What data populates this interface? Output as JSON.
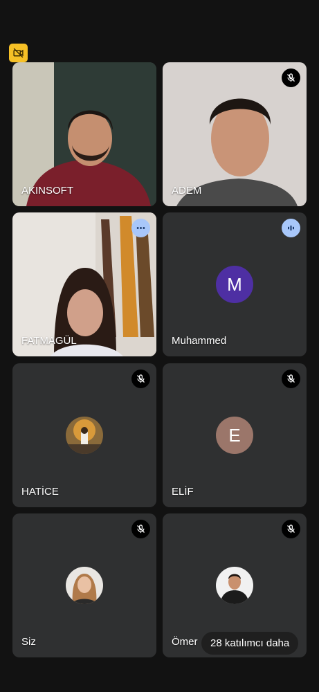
{
  "colors": {
    "background": "#121212",
    "tile": "#2f3031",
    "badge": "#f6c026",
    "accent_light_blue": "#a8c7fa",
    "avatar_m": "#4e2fa3",
    "avatar_e": "#9b766a"
  },
  "top_badge": {
    "icon": "camera-off-icon"
  },
  "participants": [
    {
      "name": "AKINSOFT",
      "tile": "video",
      "mic": "on"
    },
    {
      "name": "ADEM",
      "tile": "video",
      "mic": "muted"
    },
    {
      "name": "FATMAGÜL",
      "tile": "video",
      "indicator": "more-options"
    },
    {
      "name": "Muhammed",
      "tile": "avatar",
      "avatar_letter": "M",
      "indicator": "speaking"
    },
    {
      "name": "HATİCE",
      "tile": "photo-avatar",
      "mic": "muted"
    },
    {
      "name": "ELİF",
      "tile": "avatar",
      "avatar_letter": "E",
      "mic": "muted"
    },
    {
      "name": "Siz",
      "tile": "photo-avatar",
      "mic": "muted"
    },
    {
      "name": "Ömer",
      "tile": "photo-avatar",
      "mic": "muted"
    }
  ],
  "more_participants_label": "28 katılımcı daha"
}
